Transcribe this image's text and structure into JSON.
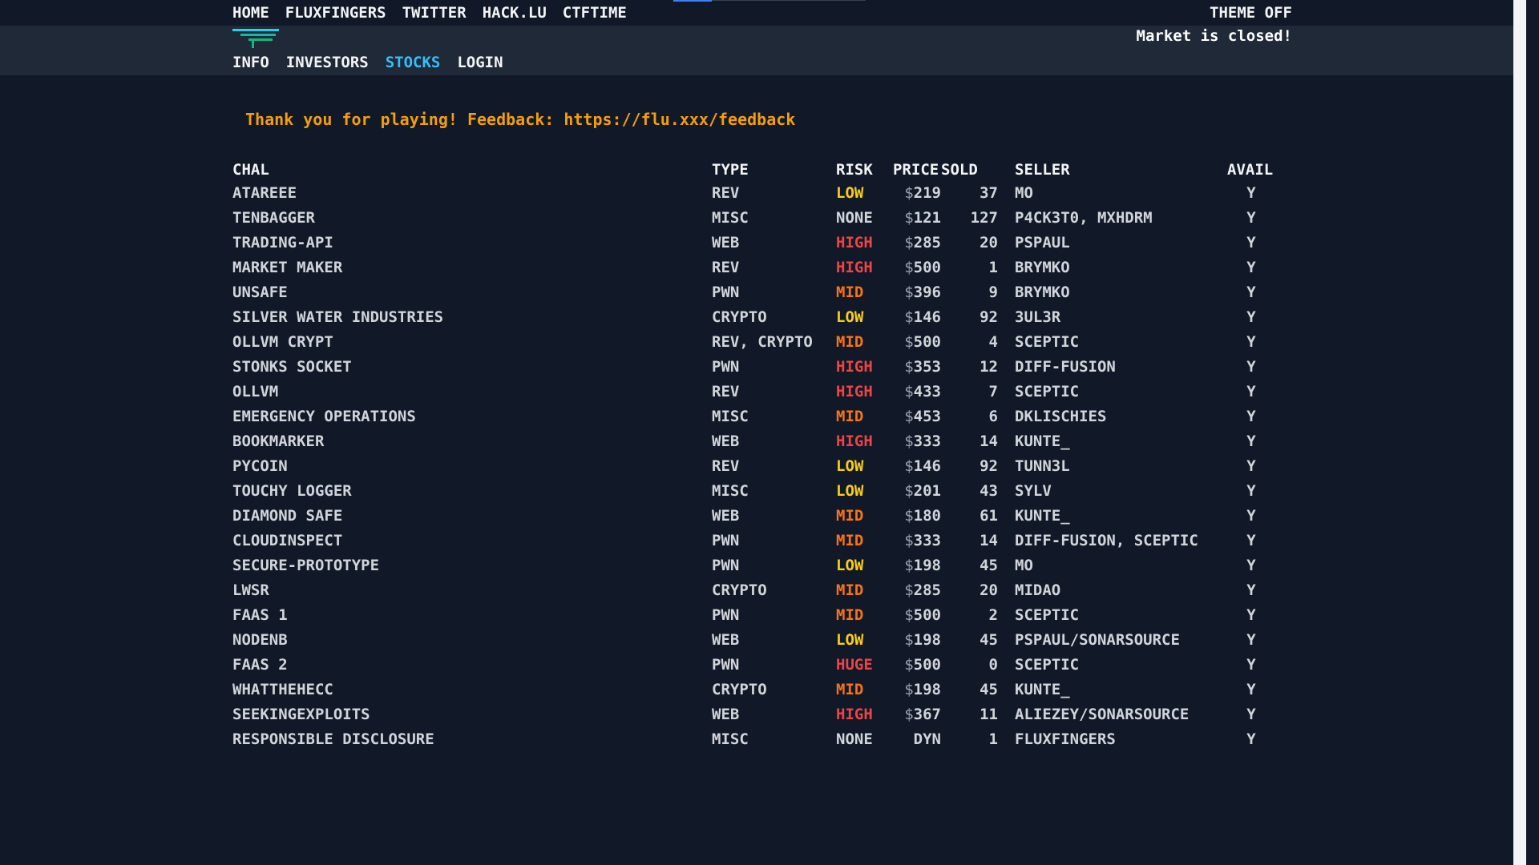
{
  "top_nav": {
    "links": [
      "HOME",
      "FLUXFINGERS",
      "TWITTER",
      "HACK.LU",
      "CTFTIME"
    ],
    "theme_toggle": "THEME OFF"
  },
  "sub_header": {
    "market_status": "Market is closed!",
    "links": [
      "INFO",
      "INVESTORS",
      "STOCKS",
      "LOGIN"
    ],
    "active_link": "STOCKS"
  },
  "feedback_text": "Thank you for playing! Feedback: https://flu.xxx/feedback",
  "colors": {
    "background": "#111827",
    "subbar": "#1f2937",
    "accent": "#38bdf8",
    "feedback": "#f59e0b",
    "risk_low": "#facc15",
    "risk_mid": "#f97316",
    "risk_high": "#ef4444",
    "risk_huge": "#ef4444",
    "risk_none": "#d1d5db",
    "avail": "#22c55e"
  },
  "table": {
    "headers": {
      "chal": "CHAL",
      "type": "TYPE",
      "risk": "RISK",
      "price": "PRICE",
      "sold": "SOLD",
      "seller": "SELLER",
      "avail": "AVAIL"
    },
    "rows": [
      {
        "chal": "ATAREEE",
        "type": "REV",
        "risk": "LOW",
        "price": "219",
        "sold": "37",
        "seller": "MO",
        "avail": "Y"
      },
      {
        "chal": "TENBAGGER",
        "type": "MISC",
        "risk": "NONE",
        "price": "121",
        "sold": "127",
        "seller": "P4CK3T0, MXHDRM",
        "avail": "Y"
      },
      {
        "chal": "TRADING-API",
        "type": "WEB",
        "risk": "HIGH",
        "price": "285",
        "sold": "20",
        "seller": "PSPAUL",
        "avail": "Y"
      },
      {
        "chal": "MARKET MAKER",
        "type": "REV",
        "risk": "HIGH",
        "price": "500",
        "sold": "1",
        "seller": "BRYMKO",
        "avail": "Y"
      },
      {
        "chal": "UNSAFE",
        "type": "PWN",
        "risk": "MID",
        "price": "396",
        "sold": "9",
        "seller": "BRYMKO",
        "avail": "Y"
      },
      {
        "chal": "SILVER WATER INDUSTRIES",
        "type": "CRYPTO",
        "risk": "LOW",
        "price": "146",
        "sold": "92",
        "seller": "3UL3R",
        "avail": "Y"
      },
      {
        "chal": "OLLVM CRYPT",
        "type": "REV, CRYPTO",
        "risk": "MID",
        "price": "500",
        "sold": "4",
        "seller": "SCEPTIC",
        "avail": "Y"
      },
      {
        "chal": "STONKS SOCKET",
        "type": "PWN",
        "risk": "HIGH",
        "price": "353",
        "sold": "12",
        "seller": "DIFF-FUSION",
        "avail": "Y"
      },
      {
        "chal": "OLLVM",
        "type": "REV",
        "risk": "HIGH",
        "price": "433",
        "sold": "7",
        "seller": "SCEPTIC",
        "avail": "Y"
      },
      {
        "chal": "EMERGENCY OPERATIONS",
        "type": "MISC",
        "risk": "MID",
        "price": "453",
        "sold": "6",
        "seller": "DKLISCHIES",
        "avail": "Y"
      },
      {
        "chal": "BOOKMARKER",
        "type": "WEB",
        "risk": "HIGH",
        "price": "333",
        "sold": "14",
        "seller": "KUNTE_",
        "avail": "Y"
      },
      {
        "chal": "PYCOIN",
        "type": "REV",
        "risk": "LOW",
        "price": "146",
        "sold": "92",
        "seller": "TUNN3L",
        "avail": "Y"
      },
      {
        "chal": "TOUCHY LOGGER",
        "type": "MISC",
        "risk": "LOW",
        "price": "201",
        "sold": "43",
        "seller": "SYLV",
        "avail": "Y"
      },
      {
        "chal": "DIAMOND SAFE",
        "type": "WEB",
        "risk": "MID",
        "price": "180",
        "sold": "61",
        "seller": "KUNTE_",
        "avail": "Y"
      },
      {
        "chal": "CLOUDINSPECT",
        "type": "PWN",
        "risk": "MID",
        "price": "333",
        "sold": "14",
        "seller": "DIFF-FUSION, SCEPTIC",
        "avail": "Y"
      },
      {
        "chal": "SECURE-PROTOTYPE",
        "type": "PWN",
        "risk": "LOW",
        "price": "198",
        "sold": "45",
        "seller": "MO",
        "avail": "Y"
      },
      {
        "chal": "LWSR",
        "type": "CRYPTO",
        "risk": "MID",
        "price": "285",
        "sold": "20",
        "seller": "MIDAO",
        "avail": "Y"
      },
      {
        "chal": "FAAS 1",
        "type": "PWN",
        "risk": "MID",
        "price": "500",
        "sold": "2",
        "seller": "SCEPTIC",
        "avail": "Y"
      },
      {
        "chal": "NODENB",
        "type": "WEB",
        "risk": "LOW",
        "price": "198",
        "sold": "45",
        "seller": "PSPAUL/SONARSOURCE",
        "avail": "Y"
      },
      {
        "chal": "FAAS 2",
        "type": "PWN",
        "risk": "HUGE",
        "price": "500",
        "sold": "0",
        "seller": "SCEPTIC",
        "avail": "Y"
      },
      {
        "chal": "WHATTHEHECC",
        "type": "CRYPTO",
        "risk": "MID",
        "price": "198",
        "sold": "45",
        "seller": "KUNTE_",
        "avail": "Y"
      },
      {
        "chal": "SEEKINGEXPLOITS",
        "type": "WEB",
        "risk": "HIGH",
        "price": "367",
        "sold": "11",
        "seller": "ALIEZEY/SONARSOURCE",
        "avail": "Y"
      },
      {
        "chal": "RESPONSIBLE DISCLOSURE",
        "type": "MISC",
        "risk": "NONE",
        "price": "DYN",
        "sold": "1",
        "seller": "FLUXFINGERS",
        "avail": "Y"
      }
    ]
  }
}
